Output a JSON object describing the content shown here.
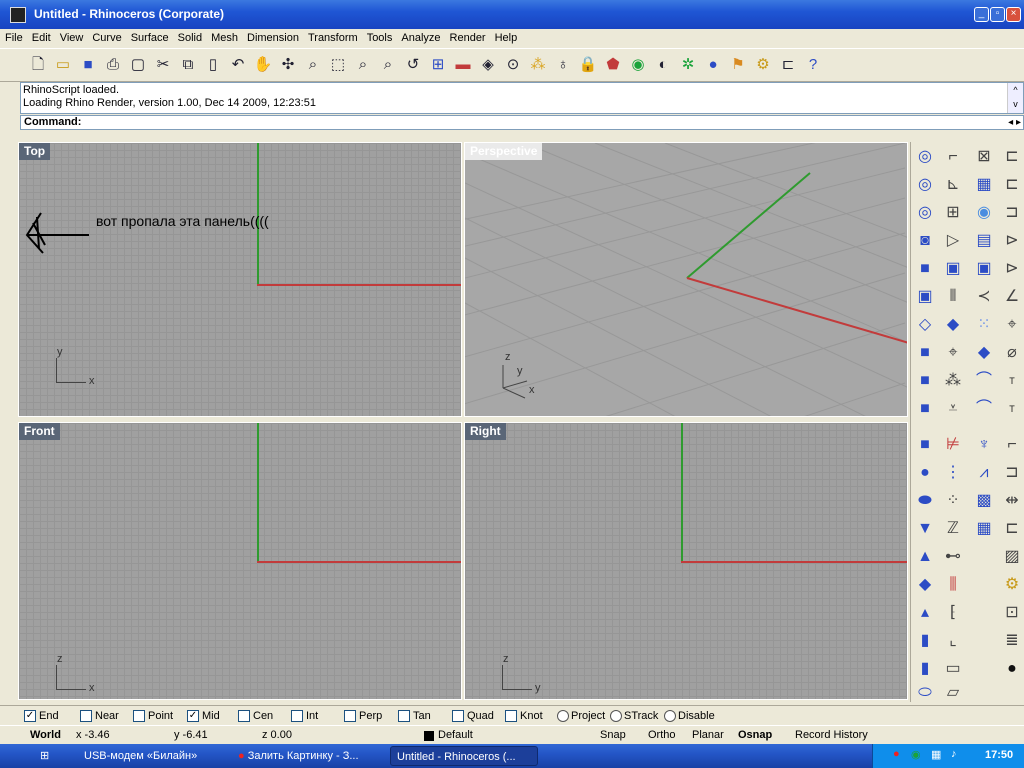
{
  "window": {
    "title": "Untitled - Rhinoceros (Corporate)"
  },
  "menu": [
    "File",
    "Edit",
    "View",
    "Curve",
    "Surface",
    "Solid",
    "Mesh",
    "Dimension",
    "Transform",
    "Tools",
    "Analyze",
    "Render",
    "Help"
  ],
  "history": [
    "RhinoScript loaded.",
    "Loading Rhino Render, version 1.00, Dec 14 2009, 12:23:51"
  ],
  "command": {
    "label": "Command:"
  },
  "viewports": {
    "top": "Top",
    "perspective": "Perspective",
    "front": "Front",
    "right": "Right"
  },
  "annotation": {
    "text": "вот пропала эта панель(((("
  },
  "axes": {
    "top": [
      "y",
      "x"
    ],
    "perspective": [
      "z",
      "y",
      "x"
    ],
    "front": [
      "z",
      "x"
    ],
    "right": [
      "z",
      "y"
    ]
  },
  "osnap": [
    {
      "label": "End",
      "checked": true
    },
    {
      "label": "Near",
      "checked": false
    },
    {
      "label": "Point",
      "checked": false
    },
    {
      "label": "Mid",
      "checked": true
    },
    {
      "label": "Cen",
      "checked": false
    },
    {
      "label": "Int",
      "checked": false
    },
    {
      "label": "Perp",
      "checked": false
    },
    {
      "label": "Tan",
      "checked": false
    },
    {
      "label": "Quad",
      "checked": false
    },
    {
      "label": "Knot",
      "checked": false
    },
    {
      "label": "Project",
      "checked": false
    },
    {
      "label": "STrack",
      "checked": false
    },
    {
      "label": "Disable",
      "checked": false
    }
  ],
  "status": {
    "world": "World",
    "x": "x -3.46",
    "y": "y -6.41",
    "z": "z 0.00",
    "layer": "Default",
    "snap": "Snap",
    "ortho": "Ortho",
    "planar": "Planar",
    "osnap": "Osnap",
    "record": "Record History"
  },
  "taskbar": {
    "t1": "USB-модем «Билайн»",
    "t2": "Залить Картинку - З...",
    "t3": "Untitled - Rhinoceros (...",
    "clock": "17:50"
  },
  "colors": {
    "x_axis": "#c23b3b",
    "y_axis": "#2f9b2f",
    "titlebar": "#1f56d4"
  }
}
